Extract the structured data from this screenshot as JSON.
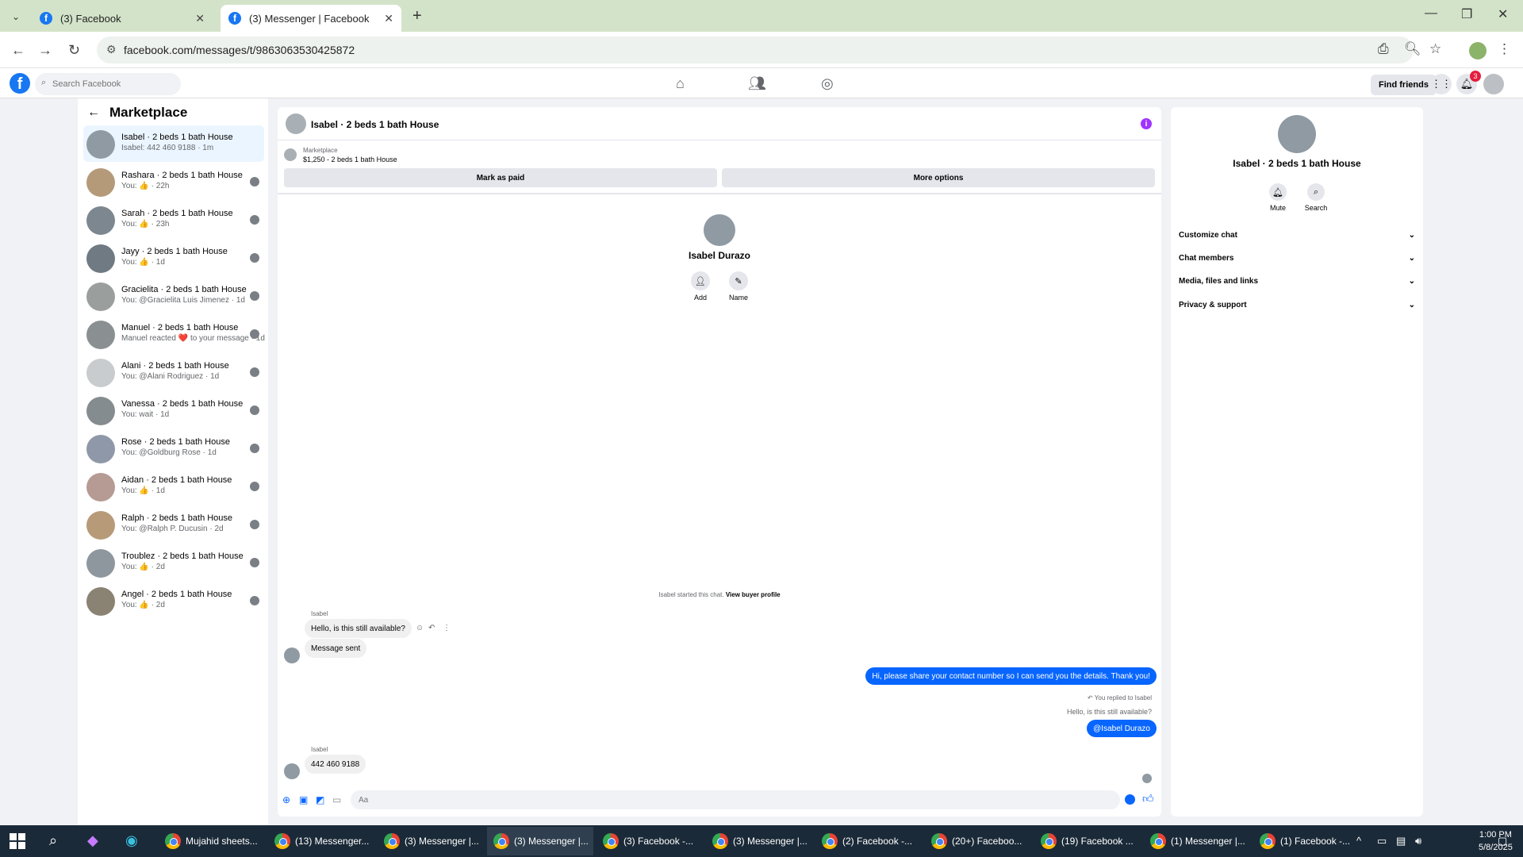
{
  "browser": {
    "tabs": [
      {
        "title": "(3) Facebook"
      },
      {
        "title": "(3) Messenger | Facebook"
      }
    ],
    "url": "facebook.com/messages/t/9863063530425872"
  },
  "fb": {
    "search_placeholder": "Search Facebook",
    "find_friends": "Find friends",
    "notif_count": "3"
  },
  "sidebar": {
    "title": "Marketplace",
    "conversations": [
      {
        "name": "Isabel · 2 beds 1 bath House",
        "preview": "Isabel: 442 460 9188 · 1m",
        "color": "#8f9aa3"
      },
      {
        "name": "Rashara · 2 beds 1 bath House",
        "preview": "You: 👍 · 22h",
        "color": "#b59a7a"
      },
      {
        "name": "Sarah · 2 beds 1 bath House",
        "preview": "You: 👍 · 23h",
        "color": "#7d8790"
      },
      {
        "name": "Jayy · 2 beds 1 bath House",
        "preview": "You: 👍 · 1d",
        "color": "#6f7a83"
      },
      {
        "name": "Gracielita · 2 beds 1 bath House",
        "preview": "You: @Gracielita Luis Jimenez · 1d",
        "color": "#9a9f9e"
      },
      {
        "name": "Manuel · 2 beds 1 bath House",
        "preview": "Manuel reacted ❤️ to your message · 1d",
        "color": "#8a8f92"
      },
      {
        "name": "Alani · 2 beds 1 bath House",
        "preview": "You: @Alani Rodriguez · 1d",
        "color": "#c8cccf"
      },
      {
        "name": "Vanessa · 2 beds 1 bath House",
        "preview": "You: wait · 1d",
        "color": "#858c8f"
      },
      {
        "name": "Rose · 2 beds 1 bath House",
        "preview": "You: @Goldburg Rose · 1d",
        "color": "#8f98a8"
      },
      {
        "name": "Aidan · 2 beds 1 bath House",
        "preview": "You: 👍 · 1d",
        "color": "#b69a94"
      },
      {
        "name": "Ralph · 2 beds 1 bath House",
        "preview": "You: @Ralph P. Ducusin · 2d",
        "color": "#b79a78"
      },
      {
        "name": "Troublez · 2 beds 1 bath House",
        "preview": "You: 👍 · 2d",
        "color": "#8e979e"
      },
      {
        "name": "Angel · 2 beds 1 bath House",
        "preview": "You: 👍 · 2d",
        "color": "#8a8272"
      }
    ]
  },
  "chat": {
    "title": "Isabel · 2 beds 1 bath House",
    "marketplace_label": "Marketplace",
    "listing": "$1,250 - 2 beds 1 bath House",
    "mark_paid": "Mark as paid",
    "more_options": "More options",
    "profile_name": "Isabel Durazo",
    "add_label": "Add",
    "name_label": "Name",
    "system_text": "Isabel started this chat.",
    "view_buyer": "View buyer profile",
    "sender": "Isabel",
    "msg1": "Hello, is this still available?",
    "msg2": "Message sent",
    "out1": "Hi, please share your contact number so I can send you the details. Thank you!",
    "reply_note": "You replied to Isabel",
    "quoted": "Hello, is this still available?",
    "out2": "@Isabel Durazo",
    "msg3": "442 460 9188",
    "composer_placeholder": "Aa"
  },
  "right": {
    "name": "Isabel · 2 beds 1 bath House",
    "mute": "Mute",
    "search": "Search",
    "sections": [
      "Customize chat",
      "Chat members",
      "Media, files and links",
      "Privacy & support"
    ]
  },
  "taskbar": {
    "apps": [
      "Mujahid sheets...",
      "(13) Messenger...",
      "(3) Messenger |...",
      "(3) Messenger |...",
      "(3) Facebook -...",
      "(3) Messenger |...",
      "(2) Facebook -...",
      "(20+) Faceboo...",
      "(19) Facebook ...",
      "(1) Messenger |...",
      "(1) Facebook -..."
    ],
    "time": "1:00 PM",
    "date": "5/8/2025"
  }
}
